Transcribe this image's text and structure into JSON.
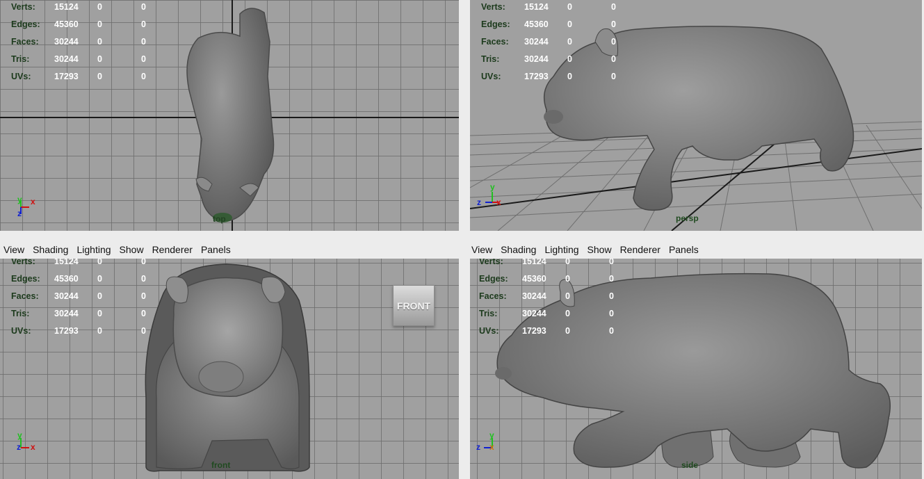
{
  "menu": [
    "View",
    "Shading",
    "Lighting",
    "Show",
    "Renderer",
    "Panels"
  ],
  "hud_stats": [
    {
      "label": "Verts:",
      "value": "15124",
      "c1": "0",
      "c2": "0"
    },
    {
      "label": "Edges:",
      "value": "45360",
      "c1": "0",
      "c2": "0"
    },
    {
      "label": "Faces:",
      "value": "30244",
      "c1": "0",
      "c2": "0"
    },
    {
      "label": "Tris:",
      "value": "30244",
      "c1": "0",
      "c2": "0"
    },
    {
      "label": "UVs:",
      "value": "17293",
      "c1": "0",
      "c2": "0"
    }
  ],
  "viewports": {
    "top": {
      "camera_label": "top"
    },
    "persp": {
      "camera_label": "persp"
    },
    "front": {
      "camera_label": "front",
      "view_cube_label": "FRONT"
    },
    "side": {
      "camera_label": "side"
    }
  },
  "axes": {
    "x": "x",
    "y": "y",
    "z": "z"
  },
  "colors": {
    "viewport_bg": "#a0a0a0",
    "grid": "#6e6e6e",
    "hud_label": "#1c3a1c",
    "hud_value": "#ffffff",
    "model": "#7a7a7a",
    "axis_x": "#d01010",
    "axis_y": "#20c020",
    "axis_z": "#1020d0"
  }
}
